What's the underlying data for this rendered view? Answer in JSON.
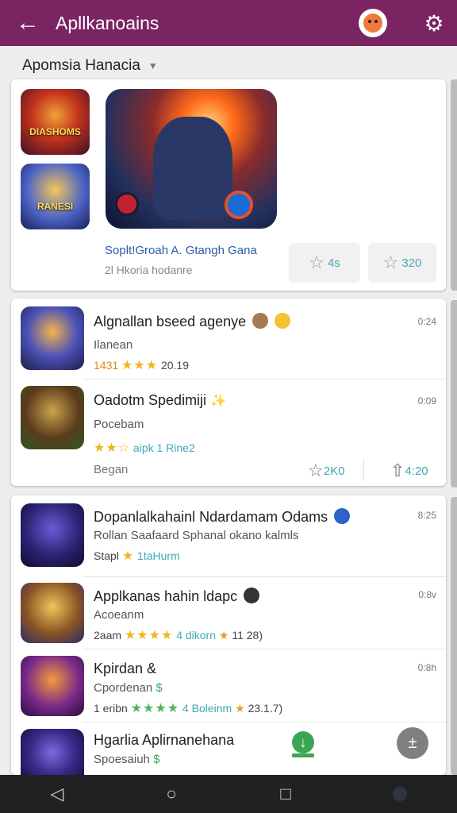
{
  "appbar": {
    "title": "Apllkanoains",
    "back_icon": "arrow-left-icon",
    "settings_icon": "gear-icon"
  },
  "filter": {
    "label": "Apomsia Hanacia"
  },
  "featured": {
    "small1_label": "DIASHOMS",
    "small2_label": "RANESI",
    "title": "Soplt!Groah A. Gtangh Gana",
    "subtitle": "2l Hkoria hodanre",
    "stat1": "4s",
    "stat2": "320"
  },
  "group1": {
    "rows": [
      {
        "name": "Algnallan bseed agenye",
        "sub": "Ilanean",
        "meta_num": "1431",
        "stars": "★★★",
        "meta_tail": "20.19",
        "time": "0:24"
      },
      {
        "name": "Oadotm Spedimiji",
        "sub": "Pocebam",
        "stars": "★★☆",
        "meta_tail": "aipk 1 Rine2",
        "time": "0:09"
      }
    ],
    "footer_label": "Began",
    "stat1": "2K0",
    "stat2": "4:20"
  },
  "group2": {
    "rows": [
      {
        "name": "Dopanlalkahainl Ndardamam Odams",
        "sub": "Rollan Saafaard Sphanal okano kalmls",
        "meta_pre": "Stapl",
        "stars": "★",
        "meta_tail": "1taHurm",
        "time": "8:25"
      },
      {
        "name": "Applkanas hahin ldapc",
        "sub": "Acoeanm",
        "meta_pre": "2aam",
        "stars": "★★★★",
        "meta_tail": "4 dikorn",
        "meta_end": "11 28)",
        "time": "0:8v"
      },
      {
        "name": "Kpirdan &",
        "sub": "Cpordenan",
        "meta_pre": "1 eribn",
        "stars": "★★★★",
        "meta_tail": "4 Boleinm",
        "meta_end": "23.1.7)",
        "time": "0:8h"
      },
      {
        "name": "Hgarlia Aplirnanehana",
        "sub": "Spoesaiuh"
      }
    ]
  }
}
